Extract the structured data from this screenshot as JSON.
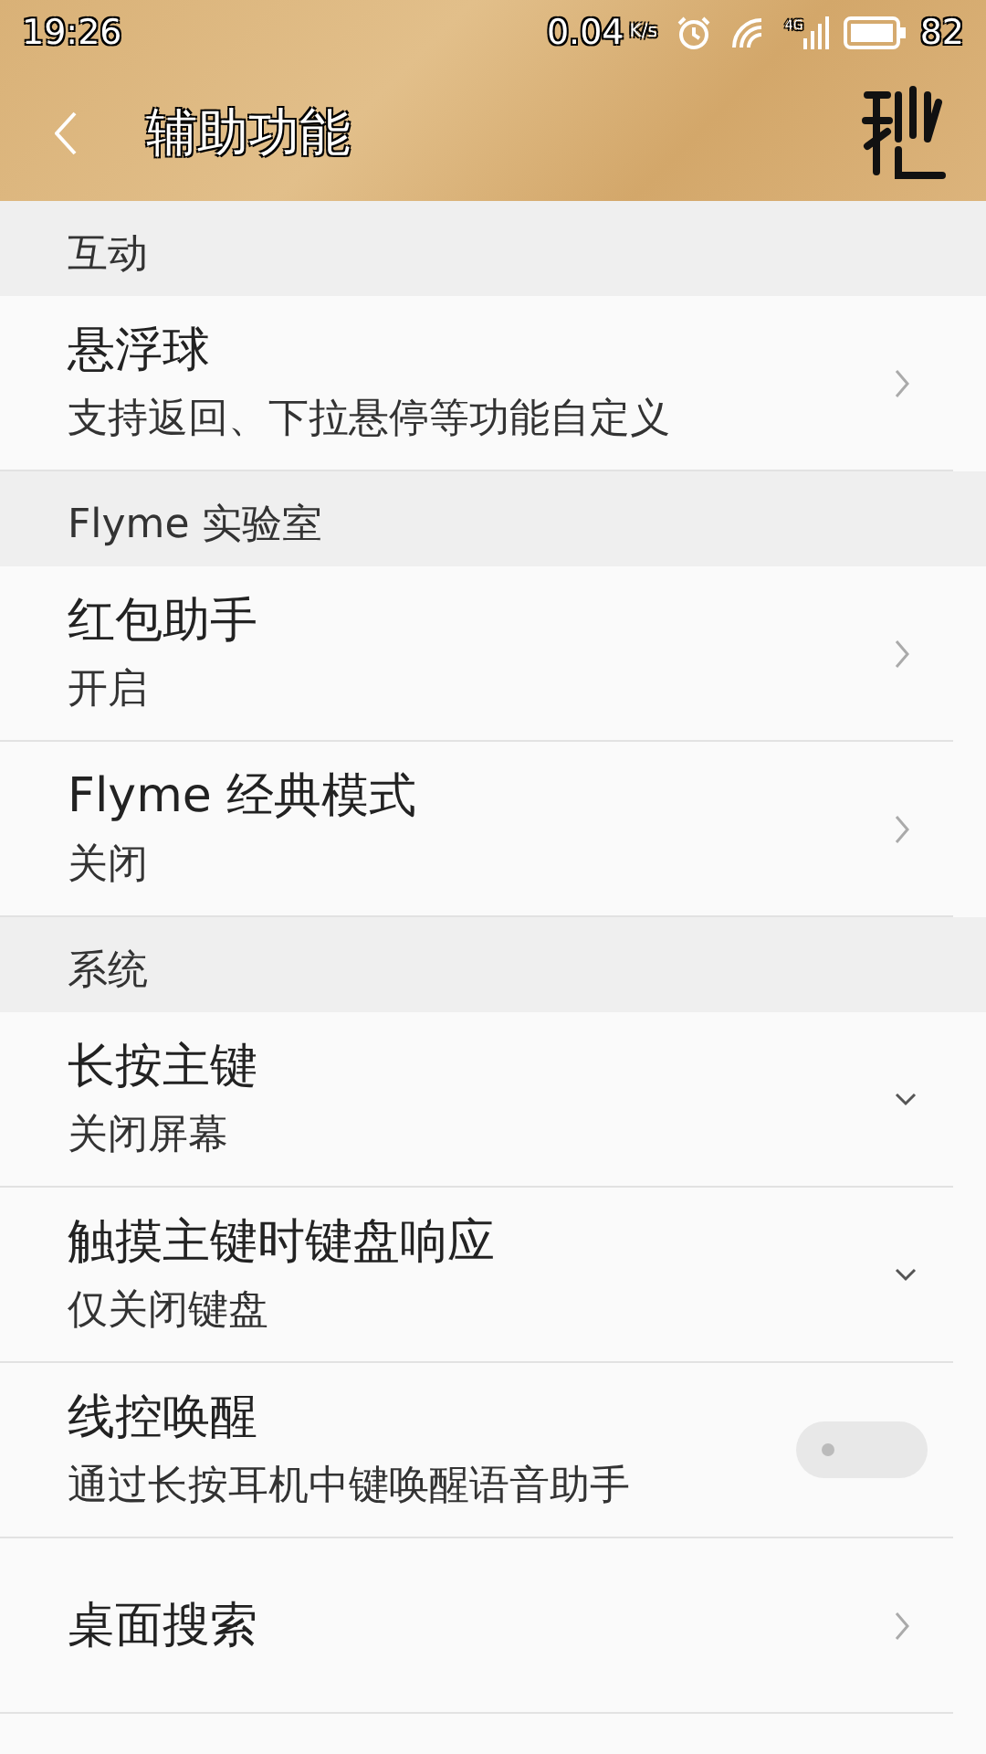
{
  "status_bar": {
    "time": "19:26",
    "speed": "0.04",
    "speed_unit": "K/s",
    "network": "4G",
    "battery": "82"
  },
  "header": {
    "title": "辅助功能"
  },
  "sections": [
    {
      "title": "互动",
      "items": [
        {
          "kind": "link",
          "title": "悬浮球",
          "subtitle": "支持返回、下拉悬停等功能自定义"
        }
      ]
    },
    {
      "title": "Flyme 实验室",
      "items": [
        {
          "kind": "link",
          "title": "红包助手",
          "subtitle": "开启"
        },
        {
          "kind": "link",
          "title": "Flyme 经典模式",
          "subtitle": "关闭"
        }
      ]
    },
    {
      "title": "系统",
      "items": [
        {
          "kind": "dropdown",
          "title": "长按主键",
          "subtitle": "关闭屏幕"
        },
        {
          "kind": "dropdown",
          "title": "触摸主键时键盘响应",
          "subtitle": "仅关闭键盘"
        },
        {
          "kind": "switch",
          "title": "线控唤醒",
          "subtitle": "通过长按耳机中键唤醒语音助手",
          "on": false
        },
        {
          "kind": "link",
          "title": "桌面搜索"
        }
      ]
    }
  ]
}
